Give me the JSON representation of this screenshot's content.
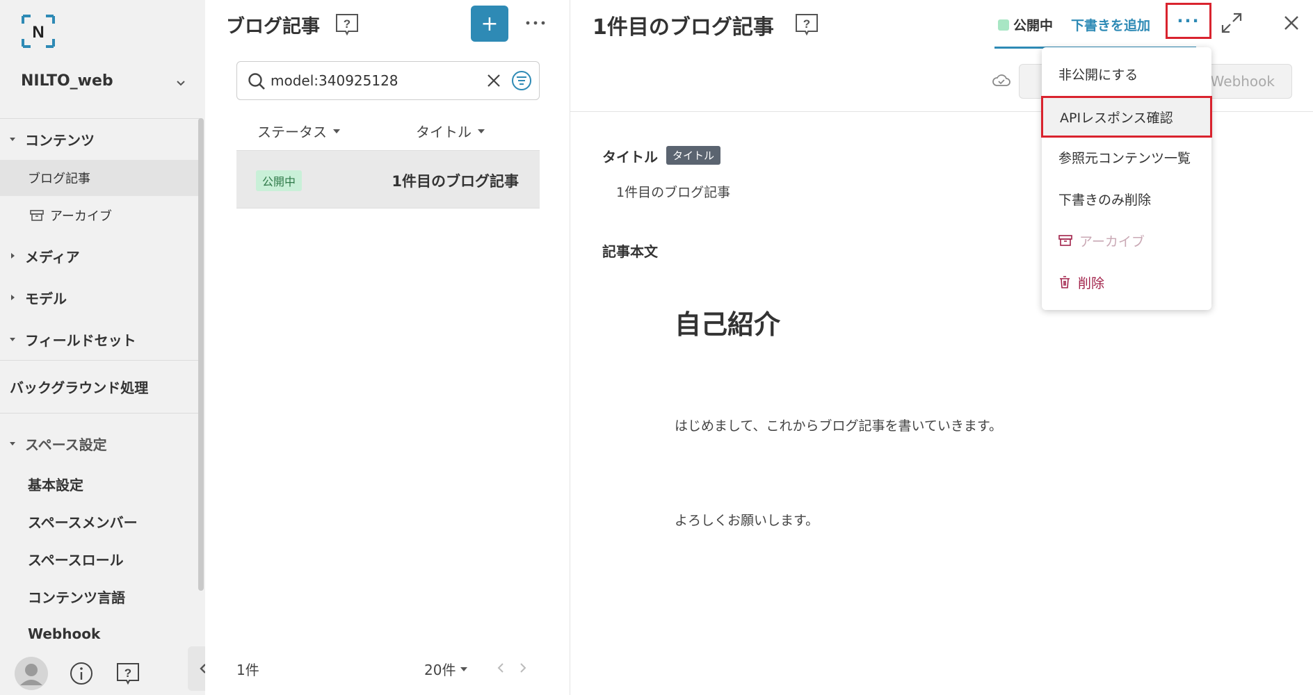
{
  "sidebar": {
    "space_name": "NILTO_web",
    "items": [
      {
        "label": "コンテンツ"
      },
      {
        "label": "ブログ記事"
      },
      {
        "label": "アーカイブ"
      },
      {
        "label": "メディア"
      },
      {
        "label": "モデル"
      },
      {
        "label": "フィールドセット"
      },
      {
        "label": "バックグラウンド処理"
      },
      {
        "label": "スペース設定"
      },
      {
        "label": "基本設定"
      },
      {
        "label": "スペースメンバー"
      },
      {
        "label": "スペースロール"
      },
      {
        "label": "コンテンツ言語"
      },
      {
        "label": "Webhook"
      }
    ]
  },
  "list": {
    "title": "ブログ記事",
    "add_label": "+",
    "search_value": "model:340925128",
    "columns": [
      "ステータス",
      "タイトル"
    ],
    "rows": [
      {
        "status": "公開中",
        "title": "1件目のブログ記事"
      }
    ],
    "count": "1件",
    "per_page": "20件"
  },
  "detail": {
    "title": "1件目のブログ記事",
    "status": "公開中",
    "draft_link": "下書きを追加",
    "more_label": "···",
    "webhook_label": "Webhook",
    "fields": {
      "title_label": "タイトル",
      "title_tag": "タイトル",
      "title_value": "1件目のブログ記事",
      "body_label": "記事本文",
      "body_heading": "自己紹介",
      "body_p1": "はじめまして、これからブログ記事を書いていきます。",
      "body_p2": "よろしくお願いします。"
    }
  },
  "menu": {
    "items": [
      {
        "label": "非公開にする"
      },
      {
        "label": "APIレスポンス確認"
      },
      {
        "label": "参照元コンテンツ一覧"
      },
      {
        "label": "下書きのみ削除"
      },
      {
        "label": "アーカイブ"
      },
      {
        "label": "削除"
      }
    ]
  },
  "colors": {
    "accent": "#2e8ab5",
    "highlight": "#d9232e",
    "danger": "#a2224a"
  }
}
